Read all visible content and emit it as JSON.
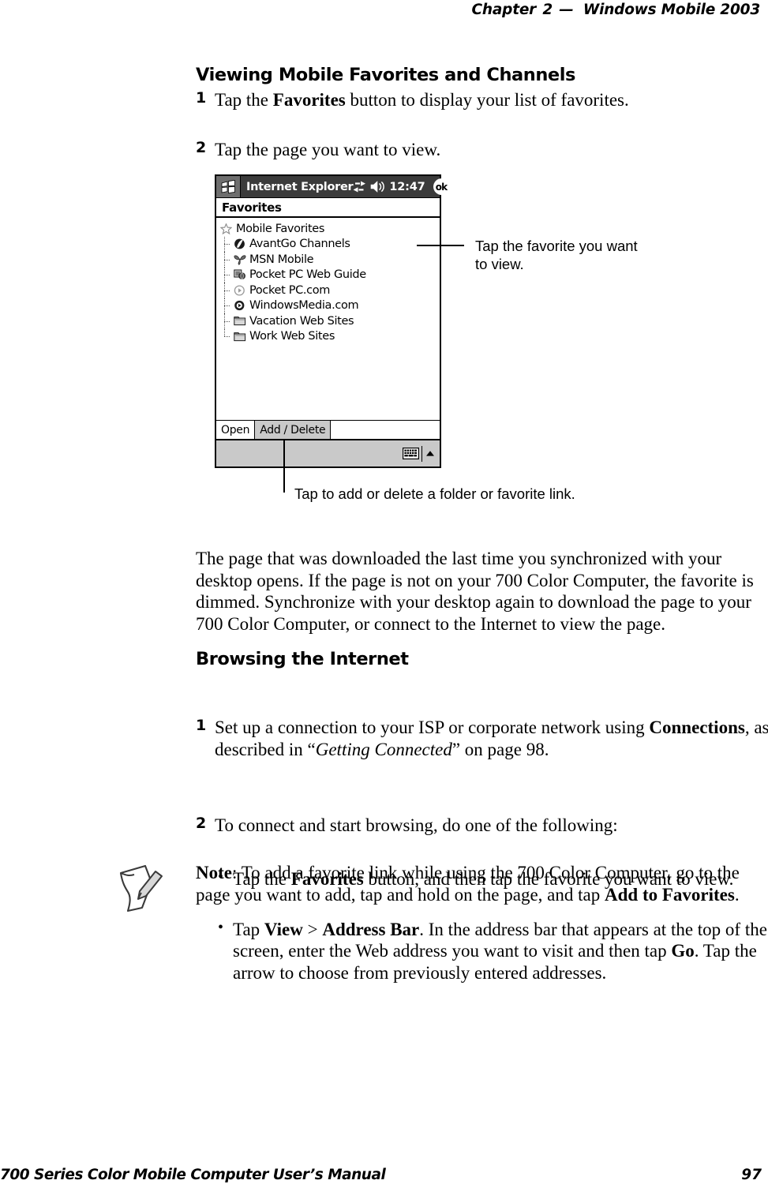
{
  "header": {
    "chapter_label": "Chapter",
    "chapter_number": "2",
    "dash": "—",
    "product": "Windows Mobile 2003"
  },
  "section_favorites": {
    "heading": "Viewing Mobile Favorites and Channels",
    "steps": [
      {
        "num": "1",
        "pre": "Tap the ",
        "bold": "Favorites",
        "post": " button to display your list of favorites."
      },
      {
        "num": "2",
        "pre": "Tap the page you want to view.",
        "bold": "",
        "post": ""
      }
    ]
  },
  "pda": {
    "start_icon": "windows-flag-icon",
    "title": "Internet Explorer",
    "connectivity_icon": "connectivity-icon",
    "speaker_icon": "speaker-icon",
    "time": "12:47",
    "ok_label": "ok",
    "page_title": "Favorites",
    "favorites": [
      {
        "label": "Mobile Favorites",
        "icon": "star-icon",
        "level": 0
      },
      {
        "label": "AvantGo Channels",
        "icon": "avantgo-icon",
        "level": 1
      },
      {
        "label": "MSN Mobile",
        "icon": "msn-butterfly-icon",
        "level": 1
      },
      {
        "label": "Pocket PC Web Guide",
        "icon": "web-guide-icon",
        "level": 1
      },
      {
        "label": "Pocket PC.com",
        "icon": "clock-icon",
        "level": 1
      },
      {
        "label": "WindowsMedia.com",
        "icon": "media-play-icon",
        "level": 1
      },
      {
        "label": "Vacation Web Sites",
        "icon": "folder-icon",
        "level": 1
      },
      {
        "label": "Work Web Sites",
        "icon": "folder-icon",
        "level": 1
      }
    ],
    "tabs": [
      {
        "label": "Open",
        "active": true
      },
      {
        "label": "Add / Delete",
        "active": false
      }
    ],
    "status": {
      "keyboard_icon": "keyboard-icon",
      "arrow_icon": "chevron-up-icon"
    }
  },
  "callouts": {
    "favorite": "Tap the favorite you want\nto view.",
    "favorite_line1": "Tap the favorite you want",
    "favorite_line2": "to view.",
    "add_delete": "Tap to add or delete a folder or favorite link."
  },
  "body_paragraph": "The page that was downloaded the last time you synchronized with your desktop opens. If the page is not on your 700 Color Computer, the favorite is dimmed. Synchronize with your desktop again to download the page to your 700 Color Computer, or connect to the Internet to view the page.",
  "section_browsing": {
    "heading": "Browsing the Internet",
    "step1": {
      "num": "1",
      "t1": "Set up a connection to your ISP or corporate network using ",
      "b1": "Connections",
      "t2": ", as described in “",
      "i1": "Getting Connected",
      "t3": "” on page 98."
    },
    "step2": {
      "num": "2",
      "text": "To connect and start browsing, do one of the following:"
    },
    "bullets": [
      {
        "bullet_char": "•",
        "t1": "Tap the ",
        "b1": "Favorites",
        "t2": " button, and then tap the favorite you want to view."
      },
      {
        "bullet_char": "•",
        "t1": "Tap ",
        "b1": "View",
        "t2": " > ",
        "b2": "Address Bar",
        "t3": ". In the address bar that appears at the top of the screen, enter the Web address you want to visit and then tap ",
        "b3": "Go",
        "t4": ". Tap the arrow to choose from previously entered addresses."
      }
    ]
  },
  "note": {
    "icon": "note-pencil-icon",
    "label": "Note",
    "t1": ": To add a favorite link while using the 700 Color Computer, go to the page you want to add, tap and hold on the page, and tap ",
    "b1": "Add to Favorites",
    "t2": "."
  },
  "footer": {
    "title": "700 Series Color Mobile Computer User’s Manual",
    "page": "97"
  }
}
